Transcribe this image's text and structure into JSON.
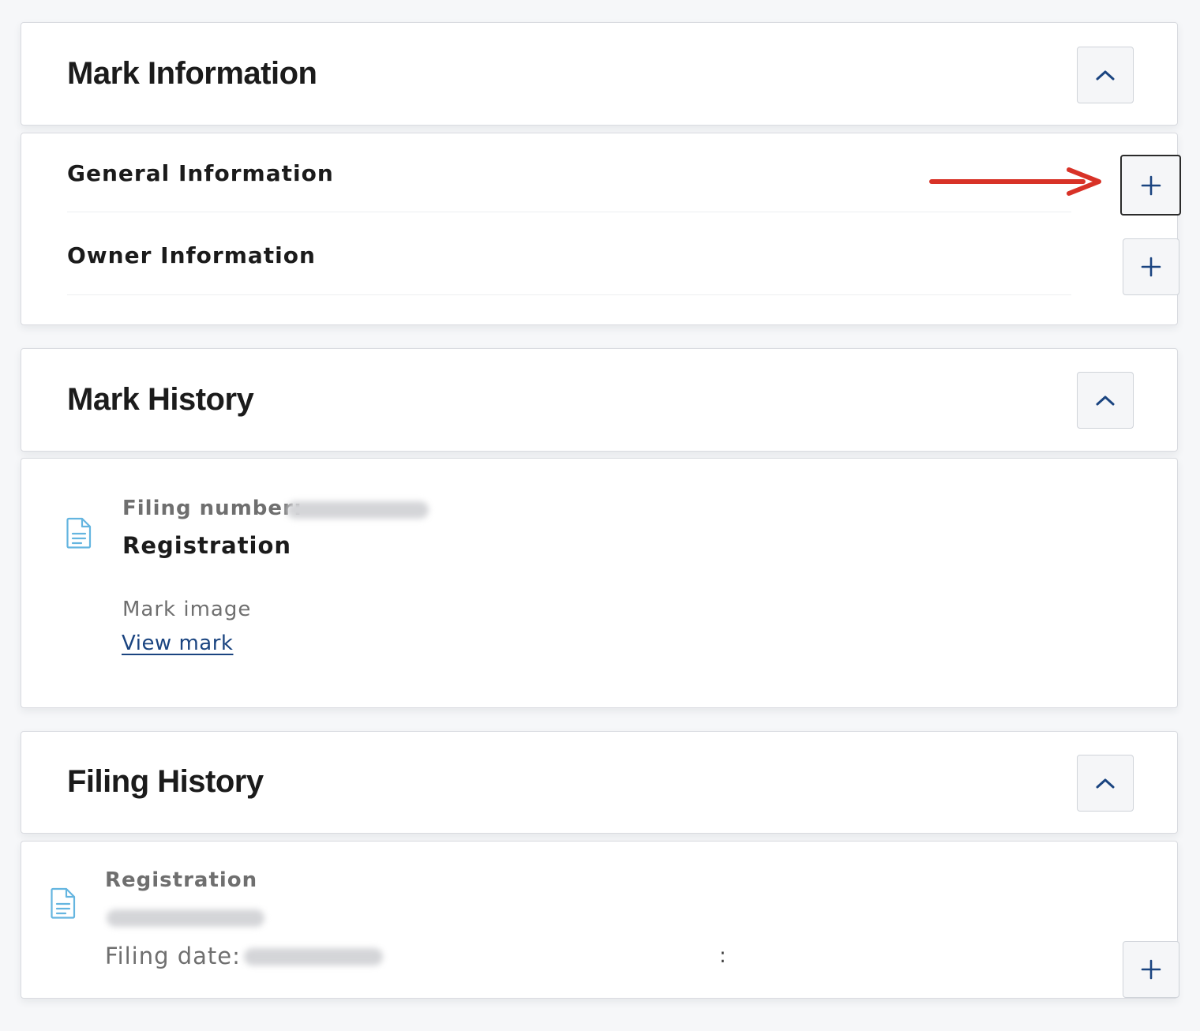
{
  "mark_information": {
    "title": "Mark Information",
    "rows": [
      {
        "label": "General Information"
      },
      {
        "label": "Owner Information"
      }
    ]
  },
  "mark_history": {
    "title": "Mark History",
    "entry": {
      "filing_number_label": "Filing number:",
      "type": "Registration",
      "mark_image_label": "Mark image",
      "view_mark_link": "View mark"
    }
  },
  "filing_history": {
    "title": "Filing History",
    "entry": {
      "type": "Registration",
      "filing_date_label": "Filing date:",
      "separator": ":"
    }
  },
  "colors": {
    "page_background": "#f6f7f9",
    "card_border": "#d9dbe0",
    "button_icon": "#1a4480",
    "document_icon": "#64b5e0",
    "link": "#1a4480",
    "annotation_arrow": "#d83227"
  },
  "icons": {
    "collapse": "chevron-up-icon",
    "expand": "plus-icon",
    "document": "document-icon",
    "annotation": "red-arrow"
  }
}
